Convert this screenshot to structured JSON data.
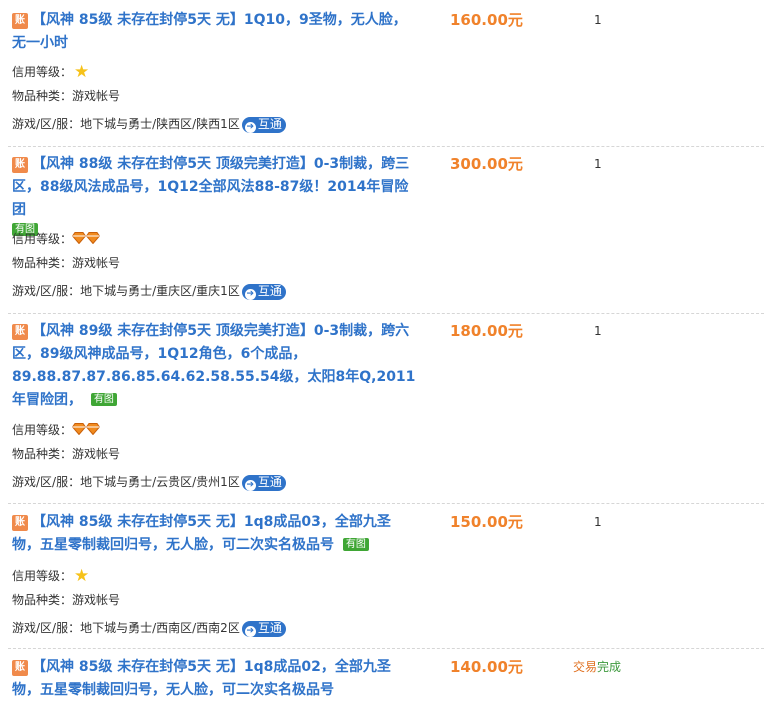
{
  "labels": {
    "credit": "信用等级：",
    "category": "物品种类：",
    "server": "游戏/区/服：",
    "zhang_tag": "账",
    "has_pic": "有图",
    "hutong": "互通",
    "hutong_icon": "➔"
  },
  "listings": [
    {
      "title": "【风神 85级 未存在封停5天 无】1Q10，9圣物，无人脸，无一小时",
      "has_pic": false,
      "price": "160.00元",
      "qty": "1",
      "credit": {
        "type": "star",
        "count": 1
      },
      "category": "游戏帐号",
      "server": "地下城与勇士/陕西区/陕西1区"
    },
    {
      "title": "【风神 88级 未存在封停5天 顶级完美打造】0-3制裁，跨三区，88级风法成品号，1Q12全部风法88-87级！2014年冒险团",
      "has_pic": true,
      "price": "300.00元",
      "qty": "1",
      "credit": {
        "type": "diamond",
        "count": 2
      },
      "category": "游戏帐号",
      "server": "地下城与勇士/重庆区/重庆1区"
    },
    {
      "title": "【风神 89级 未存在封停5天 顶级完美打造】0-3制裁，跨六区，89级风神成品号，1Q12角色，6个成品，89.88.87.87.86.85.64.62.58.55.54级，太阳8年Q,2011年冒险团，",
      "has_pic": true,
      "price": "180.00元",
      "qty": "1",
      "credit": {
        "type": "diamond",
        "count": 2
      },
      "category": "游戏帐号",
      "server": "地下城与勇士/云贵区/贵州1区"
    },
    {
      "title": "【风神 85级 未存在封停5天 无】1q8成品03，全部九圣物，五星零制裁回归号，无人脸，可二次实名极品号",
      "has_pic": true,
      "price": "150.00元",
      "qty": "1",
      "credit": {
        "type": "star",
        "count": 1
      },
      "category": "游戏帐号",
      "server": "地下城与勇士/西南区/西南2区"
    },
    {
      "title": "【风神 85级 未存在封停5天 无】1q8成品02，全部九圣物，五星零制裁回归号，无人脸，可二次实名极品号",
      "has_pic": false,
      "price": "140.00元",
      "status_part1": "交易",
      "status_part2": "完成"
    }
  ],
  "colors": {
    "title": "#2f73c9",
    "price": "#f0822b",
    "tag": "#f08a4b",
    "pic_badge": "#3fa635",
    "hutong": "#2f73c9",
    "star": "#f6c21a",
    "diamond": "#f08a1e"
  },
  "icons": {
    "tag": "zhang-tag-icon",
    "star": "star-icon",
    "diamond": "diamond-icon",
    "hutong": "arrow-circle-icon"
  }
}
